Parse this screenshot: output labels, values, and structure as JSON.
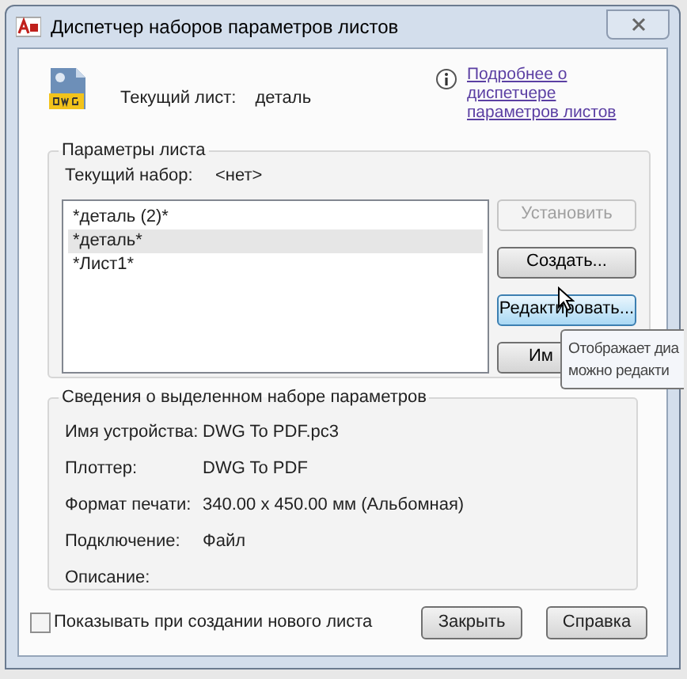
{
  "window": {
    "title": "Диспетчер наборов параметров листов"
  },
  "header": {
    "current_sheet_label": "Текущий лист:",
    "current_sheet_value": "деталь",
    "help_link_lines": [
      "Подробнее о",
      "диспетчере",
      "параметров листов"
    ]
  },
  "page_setups": {
    "title": "Параметры листа",
    "current_set_label": "Текущий набор:",
    "current_set_value": "<нет>",
    "items": [
      {
        "label": "*деталь (2)*",
        "selected": false
      },
      {
        "label": "*деталь*",
        "selected": true
      },
      {
        "label": "*Лист1*",
        "selected": false
      }
    ],
    "buttons": [
      {
        "label": "Установить",
        "disabled": true,
        "hover": false
      },
      {
        "label": "Создать...",
        "disabled": false,
        "hover": false
      },
      {
        "label": "Редактировать...",
        "disabled": false,
        "hover": true
      },
      {
        "label": "Им",
        "disabled": false,
        "hover": false
      }
    ]
  },
  "tooltip": {
    "lines": [
      "Отображает диа",
      "можно редакти"
    ]
  },
  "details": {
    "title": "Сведения о выделенном наборе параметров",
    "rows": [
      {
        "label": "Имя устройства:",
        "value": "DWG To PDF.pc3"
      },
      {
        "label": "Плоттер:",
        "value": "DWG To PDF"
      },
      {
        "label": "Формат печати:",
        "value": "340.00 x 450.00 мм (Альбомная)"
      },
      {
        "label": "Подключение:",
        "value": "Файл"
      },
      {
        "label": "Описание:"
      }
    ]
  },
  "footer": {
    "checkbox": {
      "label": "Показывать при создании нового листа",
      "checked": false
    },
    "buttons": [
      "Закрыть",
      "Справка"
    ]
  }
}
